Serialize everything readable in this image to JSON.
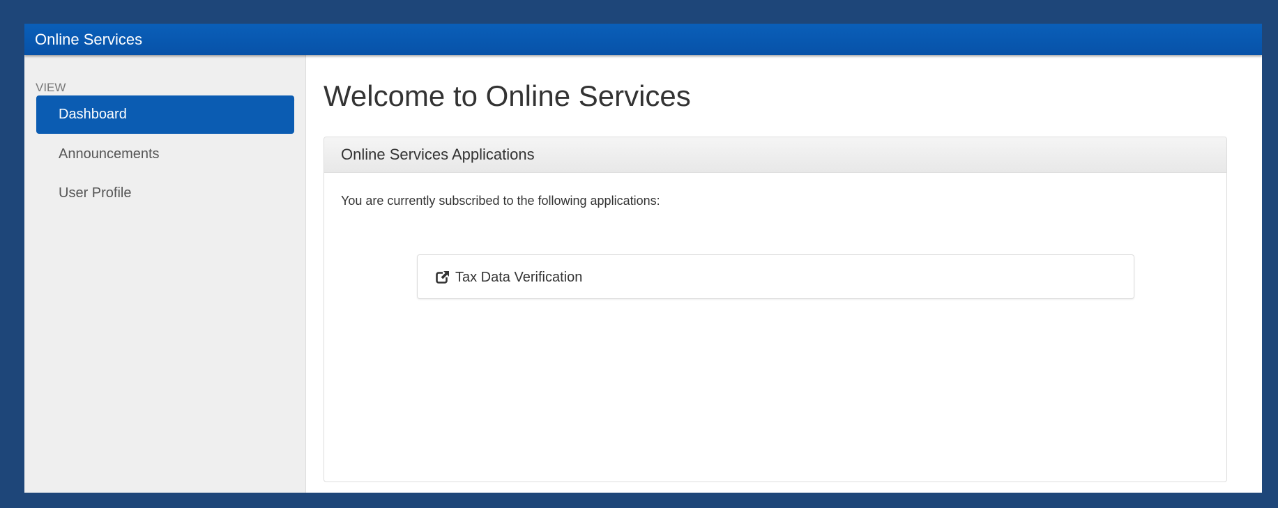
{
  "colors": {
    "frame_background": "#1e4679",
    "topbar": "#0752a8",
    "nav_active": "#0b5cb2",
    "sidebar_background": "#efefef"
  },
  "header": {
    "brand": "Online Services"
  },
  "sidebar": {
    "heading": "VIEW",
    "items": [
      {
        "label": "Dashboard",
        "active": true
      },
      {
        "label": "Announcements",
        "active": false
      },
      {
        "label": "User Profile",
        "active": false
      }
    ]
  },
  "main": {
    "title": "Welcome to Online Services",
    "panel": {
      "heading": "Online Services Applications",
      "intro": "You are currently subscribed to the following applications:",
      "applications": [
        {
          "label": "Tax Data Verification",
          "icon": "external-link-icon"
        }
      ]
    }
  }
}
